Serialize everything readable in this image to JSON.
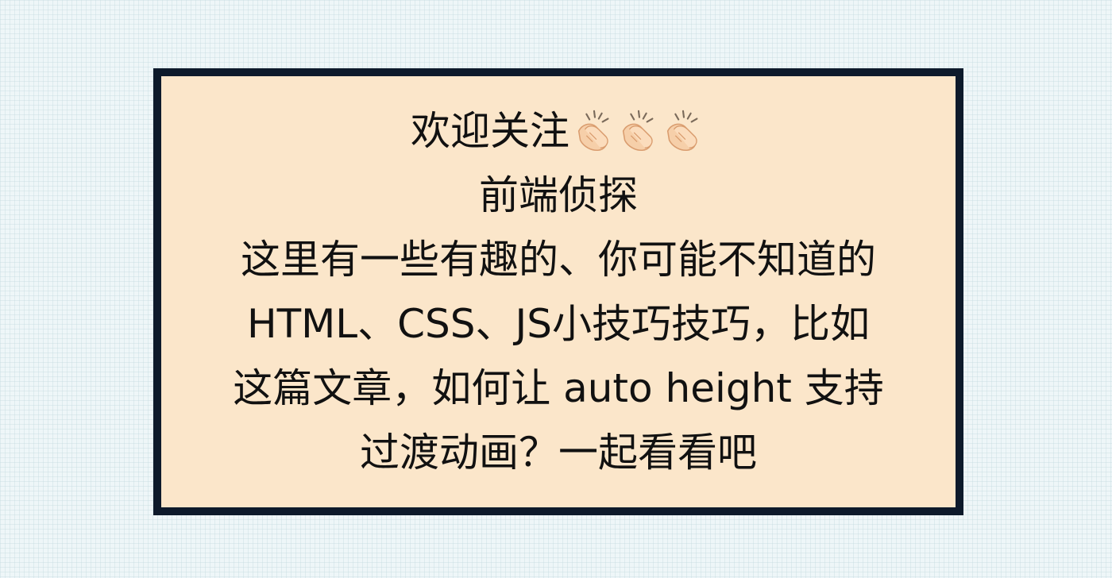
{
  "card": {
    "welcome": "欢迎关注",
    "welcome_icons": [
      "clapping-hands-icon",
      "clapping-hands-icon",
      "clapping-hands-icon"
    ],
    "account_name": "前端侦探",
    "lines": [
      "这里有一些有趣的、你可能不知道的",
      "HTML、CSS、JS小技巧技巧，比如",
      "这篇文章，如何让 auto height 支持",
      "过渡动画？一起看看吧"
    ]
  },
  "colors": {
    "background": "#eef6f8",
    "card_background": "#fbe6ca",
    "card_border": "#0d1a2b",
    "text": "#111111"
  }
}
